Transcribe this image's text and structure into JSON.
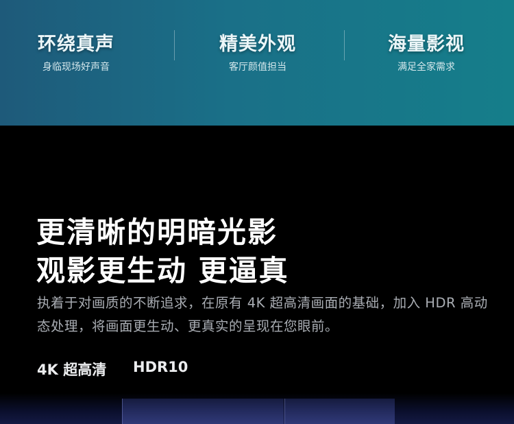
{
  "features": [
    {
      "title": "环绕真声",
      "subtitle": "身临现场好声音"
    },
    {
      "title": "精美外观",
      "subtitle": "客厅颜值担当"
    },
    {
      "title": "海量影视",
      "subtitle": "满足全家需求"
    }
  ],
  "headline": {
    "line1": "更清晰的明暗光影",
    "line2": "观影更生动 更逼真"
  },
  "description": "执着于对画质的不断追求，在原有 4K 超高清画面的基础，加入 HDR 高动态处理，将画面更生动、更真实的呈现在您眼前。",
  "tags": [
    "4K 超高清",
    "HDR10"
  ]
}
